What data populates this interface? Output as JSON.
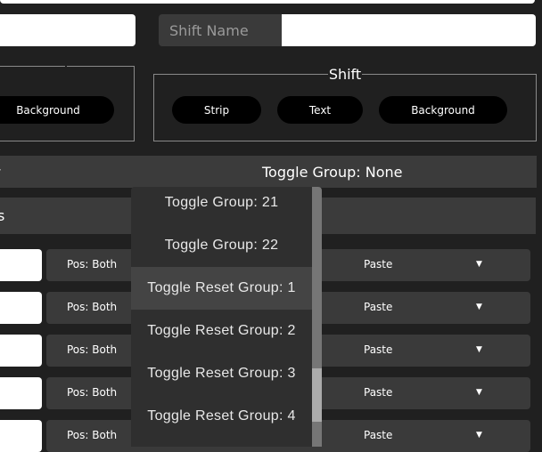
{
  "shift_name_label": "Shift Name",
  "left_group": {
    "buttons": [
      "Background"
    ]
  },
  "shift_group": {
    "legend": "Shift",
    "buttons": [
      "Strip",
      "Text",
      "Background"
    ]
  },
  "bar1": {
    "left_text": "r",
    "value": "Toggle Group: None"
  },
  "bar2": {
    "left_text": "s"
  },
  "rows": [
    {
      "pos": "Pos: Both",
      "paste": "Paste"
    },
    {
      "pos": "Pos: Both",
      "paste": "Paste"
    },
    {
      "pos": "Pos: Both",
      "paste": "Paste"
    },
    {
      "pos": "Pos: Both",
      "paste": "Paste"
    },
    {
      "pos": "Pos: Both",
      "paste": "Paste"
    }
  ],
  "dropdown": {
    "items": [
      "Toggle Group: 21",
      "Toggle Group: 22",
      "Toggle Reset Group: 1",
      "Toggle Reset Group: 2",
      "Toggle Reset Group: 3",
      "Toggle Reset Group: 4"
    ],
    "highlighted_index": 2
  }
}
